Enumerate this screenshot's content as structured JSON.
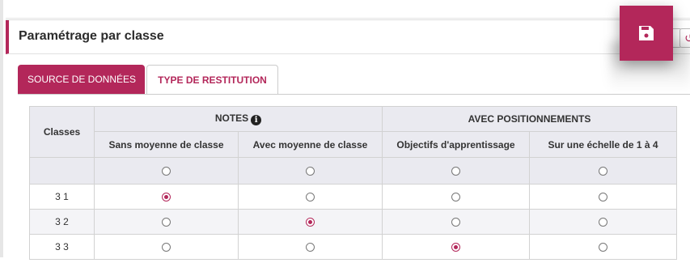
{
  "panel": {
    "title": "Paramétrage par classe"
  },
  "tabs": [
    {
      "label": "SOURCE DE DONNÉES",
      "active": false
    },
    {
      "label": "TYPE DE RESTITUTION",
      "active": true
    }
  ],
  "table": {
    "classes_header": "Classes",
    "groups": [
      {
        "label": "NOTES",
        "info_icon": "info-icon"
      },
      {
        "label": "AVEC POSITIONNEMENTS"
      }
    ],
    "columns": [
      "Sans moyenne de classe",
      "Avec moyenne de classe",
      "Objectifs d'apprentissage",
      "Sur une échelle de 1 à 4"
    ],
    "rows": [
      {
        "label": "3 1",
        "selected_column": 0
      },
      {
        "label": "3 2",
        "selected_column": 1
      },
      {
        "label": "3 3",
        "selected_column": 2
      }
    ]
  },
  "icons": {
    "save": "floppy-disk-icon",
    "undo": "undo-icon"
  },
  "colors": {
    "accent": "#b3275a"
  }
}
